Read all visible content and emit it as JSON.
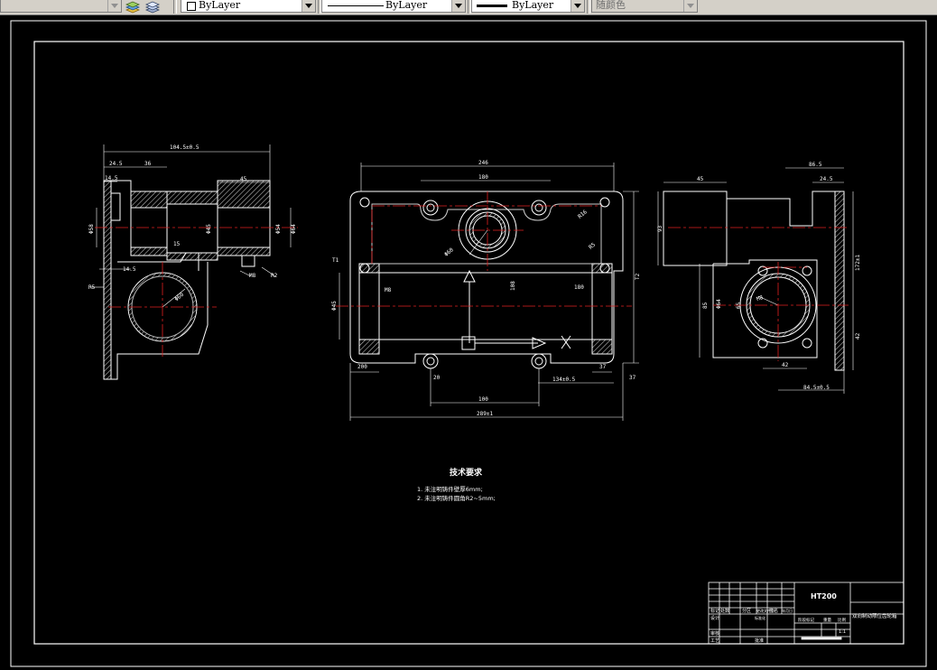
{
  "toolbar": {
    "layer_color_dropdown": "ByLayer",
    "linetype_dropdown": "ByLayer",
    "lineweight_dropdown": "ByLayer",
    "plotstyle_dropdown": "随颜色"
  },
  "drawing": {
    "left_view": {
      "dims": [
        "104.5±0.5",
        "24.5",
        "36",
        "14.5",
        "45",
        "Φ58",
        "Φ45",
        "Φ54",
        "15",
        "Φ64",
        "14.5",
        "Φ60",
        "R5",
        "M8",
        "R2"
      ]
    },
    "front_view": {
      "dims": [
        "246",
        "180",
        "R16",
        "Φ60",
        "R5",
        "T1",
        "M8",
        "Φ45",
        "108",
        "200",
        "37",
        "37",
        "T2",
        "180",
        "20",
        "100",
        "134±0.5",
        "289±1"
      ]
    },
    "right_view": {
      "dims": [
        "45",
        "86.5",
        "24.5",
        "93",
        "172±1",
        "42",
        "M8",
        "85",
        "Φ64",
        "65",
        "42",
        "84.5±0.5"
      ]
    },
    "tech_requirements": {
      "title": "技术要求",
      "items": [
        "1. 未注明铸件壁厚6mm;",
        "2. 未注明铸件圆角R2~5mm;"
      ]
    },
    "title_block": {
      "material": "HT200",
      "part_name": "双向制动限位齿轮箱",
      "row_labels": [
        "标记",
        "处数",
        "分区",
        "更改文件号",
        "签名",
        "年月日",
        "设计",
        "标准化",
        "阶段标记",
        "重量",
        "比例",
        "审核",
        "工艺",
        "批准"
      ],
      "scale": "1:1"
    }
  }
}
